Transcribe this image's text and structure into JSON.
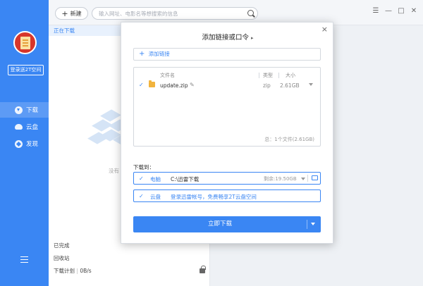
{
  "sidebar": {
    "login_label": "登录送2T空间",
    "items": [
      {
        "label": "下载",
        "icon": "download-icon",
        "active": true
      },
      {
        "label": "云盘",
        "icon": "cloud-icon",
        "active": false
      },
      {
        "label": "发现",
        "icon": "discover-icon",
        "active": false
      }
    ],
    "menu_icon": "hamburger-icon",
    "accent": "#3a86f3"
  },
  "topbar": {
    "new_label": "新建",
    "search_placeholder": "输入网址、电影名等想搜索的信息",
    "window_controls": {
      "menu": "☰",
      "minimize": "—",
      "maximize": "□",
      "close": "✕"
    }
  },
  "list": {
    "active_category": "正在下载",
    "empty_text": "没有",
    "completed": "已完成",
    "recycle": "回收站",
    "plan_label": "下载计划",
    "speed": "0B/s"
  },
  "dialog": {
    "title": "添加链接或口令",
    "title_arrow": "▸",
    "add_link_label": "添加链接",
    "columns": {
      "name": "文件名",
      "type": "类型",
      "size": "大小"
    },
    "files": [
      {
        "name": "update.zip",
        "type": "zip",
        "size": "2.61GB",
        "checked": true
      }
    ],
    "summary": "总：1个文件(2.61GB)",
    "download_to_label": "下载到：",
    "destinations": [
      {
        "label": "电脑",
        "path": "C:\\迅雷下载",
        "free": "剩余:19.50GB",
        "checked": true
      },
      {
        "label": "云盘",
        "text": "登录迅雷帐号，免费畅享2T云盘空间",
        "checked": true
      }
    ],
    "submit_label": "立即下载"
  }
}
